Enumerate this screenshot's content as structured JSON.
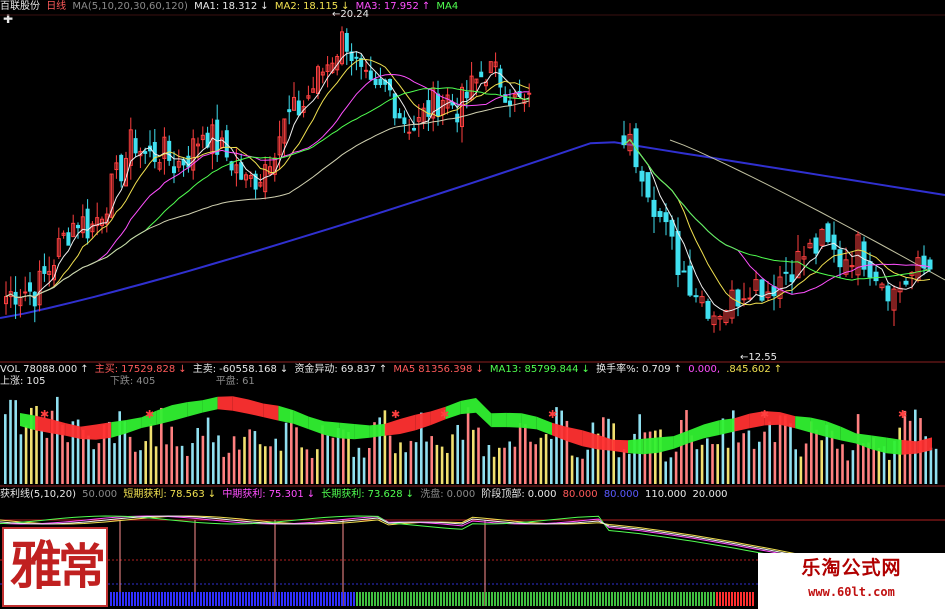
{
  "colors": {
    "up": "#ff4040",
    "down": "#40e0f0",
    "ma1": "#f0f0f0",
    "ma2": "#f0e050",
    "ma3": "#ff50ff",
    "ma4": "#50ff50",
    "ma_long": "#3030d0",
    "vol_ma_fill_green": "#30f030",
    "vol_ma_fill_red": "#ff3030",
    "bar_up": "#ff8080",
    "bar_down": "#90e0f0",
    "bar_yellow": "#f0e070",
    "grid": "#3a1a1a"
  },
  "price_header": {
    "stock_name": "百联股份",
    "period": "日线",
    "ma_def": "MA(5,10,20,30,60,120)",
    "ma1_label": "MA1:",
    "ma1_value": "18.312",
    "ma2_label": "MA2:",
    "ma2_value": "18.115",
    "ma3_label": "MA3:",
    "ma3_value": "17.952",
    "ma4_label": "MA4"
  },
  "annotations": {
    "high": "20.24",
    "low": "12.55"
  },
  "volume_header": {
    "vol_label": "VOL",
    "vol_value": "78088.000",
    "buy_label": "主买:",
    "buy_value": "17529.828",
    "sell_label": "主卖:",
    "sell_value": "-60558.168",
    "fund_label": "资金异动:",
    "fund_value": "69.837",
    "ma5_label": "MA5",
    "ma5_value": "81356.398",
    "ma13_label": "MA13:",
    "ma13_value": "85799.844",
    "turnover_label": "换手率%:",
    "turnover_value": "0.709",
    "extra1": "0.000,",
    "extra2": ".845.602"
  },
  "breadth": {
    "up_label": "上涨:",
    "up_value": "105",
    "down_label": "下跌:",
    "down_value": "405",
    "flat_label": "平盘:",
    "flat_value": "61"
  },
  "profit_header": {
    "name": "获利线(5,10,20)",
    "v50": "50.000",
    "short_label": "短期获利:",
    "short_value": "78.563",
    "mid_label": "中期获利:",
    "mid_value": "75.301",
    "long_label": "长期获利:",
    "long_value": "73.628",
    "wash_label": "洗盘:",
    "wash_value": "0.000",
    "top_label": "阶段顶部:",
    "top_value": "0.000",
    "v80a": "80.000",
    "v80b": "80.000",
    "v110": "110.000",
    "v20": "20.000"
  },
  "stamp": {
    "chars": [
      "雅",
      "常"
    ]
  },
  "watermark": {
    "title": "乐淘公式网",
    "url": "www.60lt.com"
  },
  "chart_data": {
    "type": "candlestick",
    "title": "",
    "xlabel": "",
    "ylabel": "",
    "price_range": [
      11.5,
      20.6
    ],
    "price_high": 20.24,
    "price_low": 12.55,
    "gap_note": "",
    "segments": [
      {
        "name": "",
        "closes_seed": [
          13.1,
          13.3,
          13.2,
          13.8,
          14.6,
          15.2,
          14.9,
          15.6,
          16.4,
          17.3,
          16.8,
          17.0,
          16.6,
          16.9,
          17.6,
          17.1,
          16.7,
          16.1,
          16.4,
          17.2,
          17.9,
          18.2,
          18.9,
          19.5,
          20.1,
          19.0,
          18.4,
          18.7,
          17.9,
          17.6,
          18.2,
          18.5,
          18.1,
          18.7,
          19.2,
          18.9,
          18.3,
          18.2
        ]
      },
      {
        "name": "",
        "closes_seed": [
          17.4,
          16.6,
          15.2,
          14.0,
          13.3,
          12.7,
          13.0,
          13.5,
          13.3,
          13.8,
          14.2,
          14.5,
          14.1,
          14.4,
          13.8,
          13.2,
          13.7,
          13.9
        ]
      }
    ]
  }
}
